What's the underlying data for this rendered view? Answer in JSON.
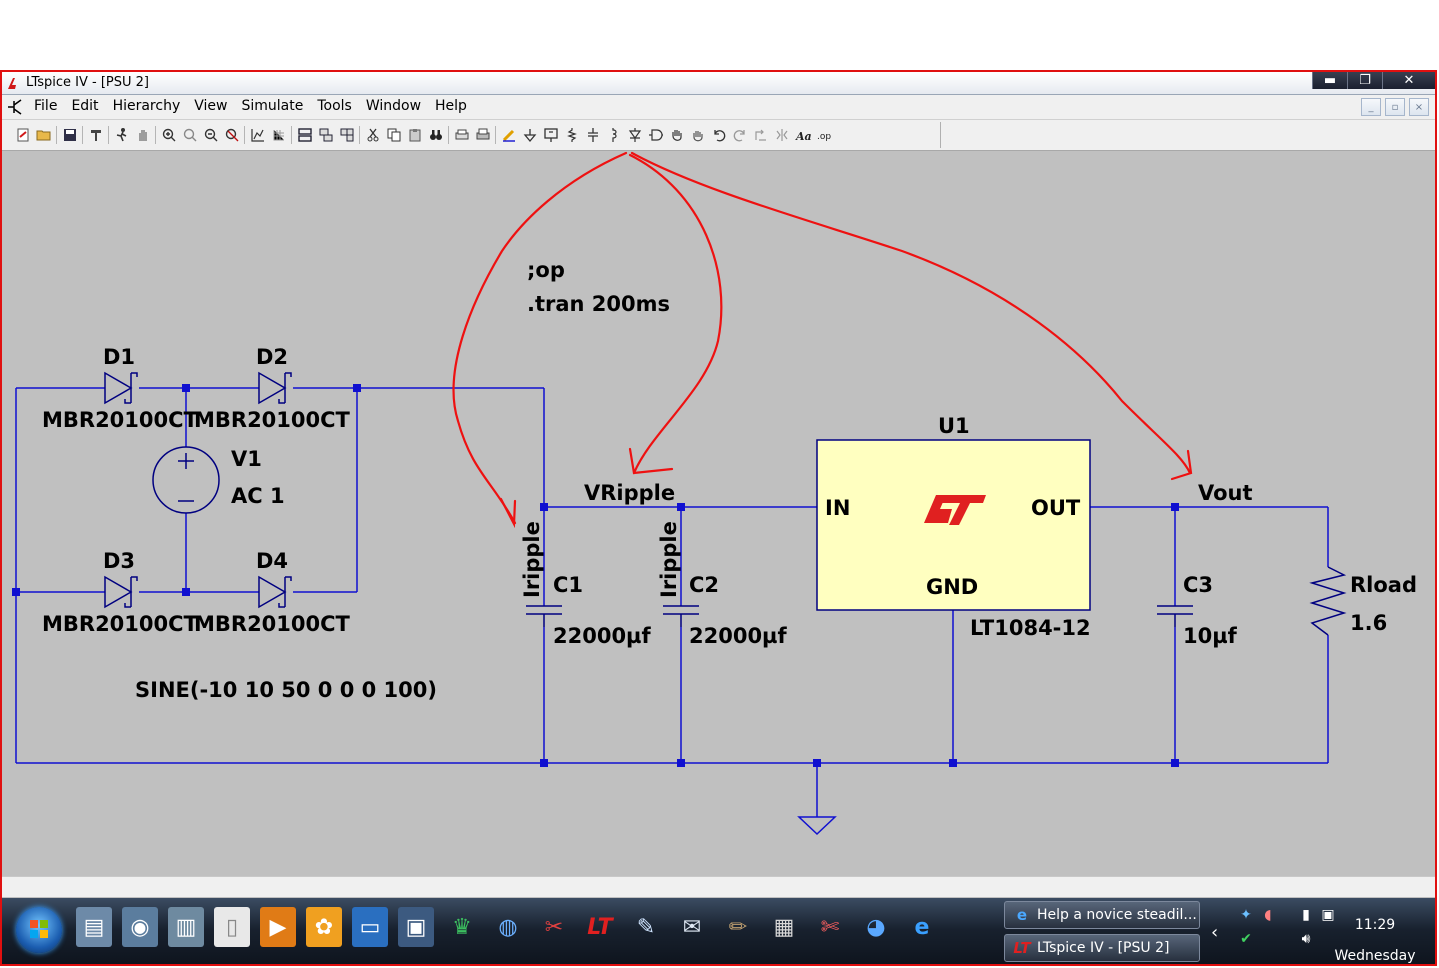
{
  "window": {
    "title": "LTspice IV - [PSU 2]",
    "controls": {
      "minimize": "▬",
      "maximize": "❐",
      "close": "✕"
    }
  },
  "menu": {
    "items": [
      "File",
      "Edit",
      "Hierarchy",
      "View",
      "Simulate",
      "Tools",
      "Window",
      "Help"
    ],
    "mdi_controls": {
      "minimize": "_",
      "restore": "▫",
      "close": "×"
    }
  },
  "schematic": {
    "directives": [
      ";op",
      ".tran 200ms"
    ],
    "components": {
      "d1": {
        "ref": "D1",
        "value": "MBR20100CT"
      },
      "d2": {
        "ref": "D2",
        "value": "MBR20100CT"
      },
      "d3": {
        "ref": "D3",
        "value": "MBR20100CT"
      },
      "d4": {
        "ref": "D4",
        "value": "MBR20100CT"
      },
      "v1": {
        "ref": "V1",
        "value": "AC 1",
        "spec": "SINE(-10 10 50 0 0 0 100)"
      },
      "c1": {
        "ref": "C1",
        "value": "22000µf"
      },
      "c2": {
        "ref": "C2",
        "value": "22000µf"
      },
      "c3": {
        "ref": "C3",
        "value": "10µf"
      },
      "u1": {
        "ref": "U1",
        "part": "LT1084-12",
        "pin_in": "IN",
        "pin_out": "OUT",
        "pin_gnd": "GND"
      },
      "rload": {
        "ref": "Rload",
        "value": "1.6"
      }
    },
    "net_labels": {
      "vripple": "VRipple",
      "vout": "Vout"
    },
    "current_labels": {
      "c1": "Iripple",
      "c2": "Iripple"
    },
    "colors": {
      "wire": "#1010d0",
      "component": "#000080",
      "background": "#c0c0c0",
      "regulator_fill": "#ffffc0",
      "annotation": "#ee1111",
      "logo": "#e02020"
    }
  },
  "taskbar": {
    "tasks": [
      {
        "icon": "e",
        "label": "Help a novice steadil..."
      },
      {
        "icon": "LT",
        "label": "LTspice IV - [PSU 2]"
      }
    ],
    "clock": {
      "time": "11:29",
      "day": "Wednesday"
    }
  }
}
